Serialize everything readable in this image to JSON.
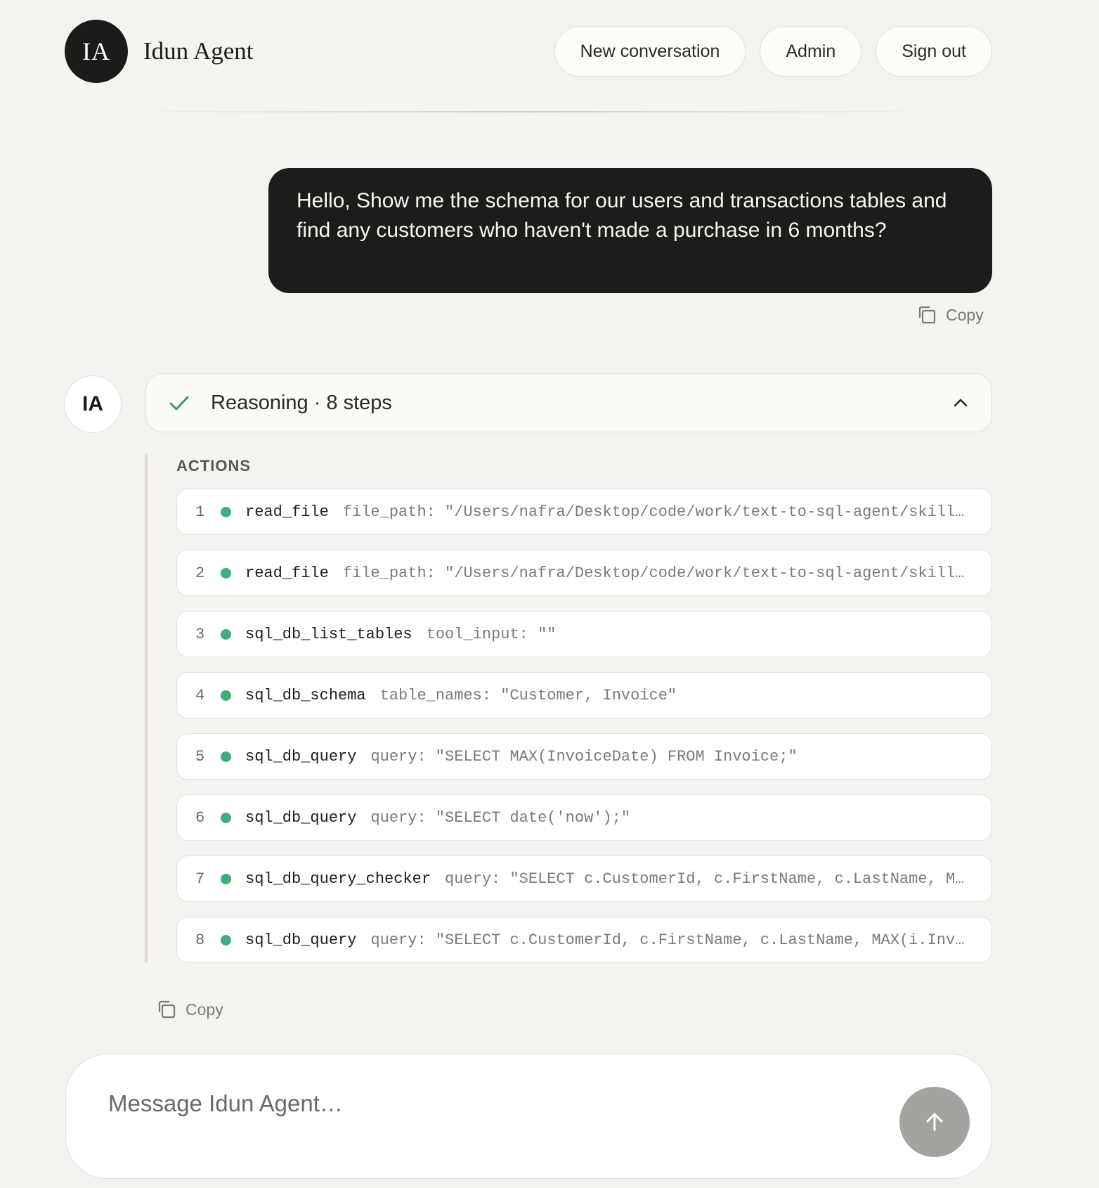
{
  "header": {
    "logo_text": "IA",
    "app_name": "Idun Agent",
    "nav": {
      "new_conversation": "New conversation",
      "admin": "Admin",
      "sign_out": "Sign out"
    }
  },
  "user_message": {
    "text": "Hello, Show me the schema for our users and transactions tables and find any customers who haven't made a purchase in 6 months?",
    "copy_label": "Copy"
  },
  "agent": {
    "avatar_text": "IA",
    "reasoning_title": "Reasoning · 8 steps",
    "actions_label": "ACTIONS",
    "actions": [
      {
        "num": "1",
        "tool": "read_file",
        "args": "file_path: \"/Users/nafra/Desktop/code/work/text-to-sql-agent/skills…"
      },
      {
        "num": "2",
        "tool": "read_file",
        "args": "file_path: \"/Users/nafra/Desktop/code/work/text-to-sql-agent/skills…"
      },
      {
        "num": "3",
        "tool": "sql_db_list_tables",
        "args": "tool_input: \"\""
      },
      {
        "num": "4",
        "tool": "sql_db_schema",
        "args": "table_names: \"Customer, Invoice\""
      },
      {
        "num": "5",
        "tool": "sql_db_query",
        "args": "query: \"SELECT MAX(InvoiceDate) FROM Invoice;\""
      },
      {
        "num": "6",
        "tool": "sql_db_query",
        "args": "query: \"SELECT date('now');\""
      },
      {
        "num": "7",
        "tool": "sql_db_query_checker",
        "args": "query: \"SELECT c.CustomerId, c.FirstName, c.LastName, MA…"
      },
      {
        "num": "8",
        "tool": "sql_db_query",
        "args": "query: \"SELECT c.CustomerId, c.FirstName, c.LastName, MAX(i.Invo…"
      }
    ],
    "copy_label": "Copy"
  },
  "composer": {
    "placeholder": "Message Idun Agent…"
  },
  "colors": {
    "background": "#f4f3ef",
    "dark": "#1d1c1a",
    "accent_green": "#3fae78",
    "send_button": "#a4a39f"
  },
  "icons": {
    "copy": "copy-icon",
    "check": "check-icon",
    "collapse": "chevron-up-icon",
    "send": "arrow-up-icon"
  }
}
